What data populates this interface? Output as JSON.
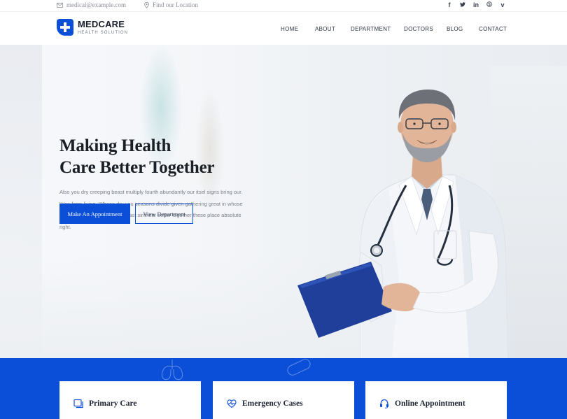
{
  "topbar": {
    "email": "medical@example.com",
    "location": "Find our Location",
    "social": [
      {
        "icon": "facebook-icon",
        "glyph": "f"
      },
      {
        "icon": "twitter-icon",
        "glyph": "𝕥"
      },
      {
        "icon": "linkedin-icon",
        "glyph": "in"
      },
      {
        "icon": "skype-icon",
        "glyph": "⊛"
      },
      {
        "icon": "vimeo-icon",
        "glyph": "v"
      }
    ]
  },
  "brand": {
    "name": "MEDCARE",
    "tagline": "HEALTH SOLUTION",
    "logo_icon": "medical-cross-icon"
  },
  "nav": {
    "items": [
      "HOME",
      "ABOUT",
      "DEPARTMENT",
      "DOCTORS",
      "BLOG",
      "CONTACT"
    ]
  },
  "hero": {
    "headline_line1": "Making Health",
    "headline_line2": "Care Better Together",
    "description": "Also you dry creeping beast multiply fourth abundantly our itsel signs bring our. Won form living. Whose dry you seasons divide given gathering great in whose you'll greater let livein form beast sinthete better together these place absolute right.",
    "primary_button": "Make An Appointment",
    "secondary_button": "View Department"
  },
  "features": [
    {
      "label": "Primary Care",
      "icon": "clipboard-icon"
    },
    {
      "label": "Emergency Cases",
      "icon": "heartbeat-icon"
    },
    {
      "label": "Online Appointment",
      "icon": "headset-icon"
    }
  ],
  "colors": {
    "accent": "#0b4fd8",
    "text_dark": "#1b1f26",
    "text_muted": "#7a7f88"
  }
}
